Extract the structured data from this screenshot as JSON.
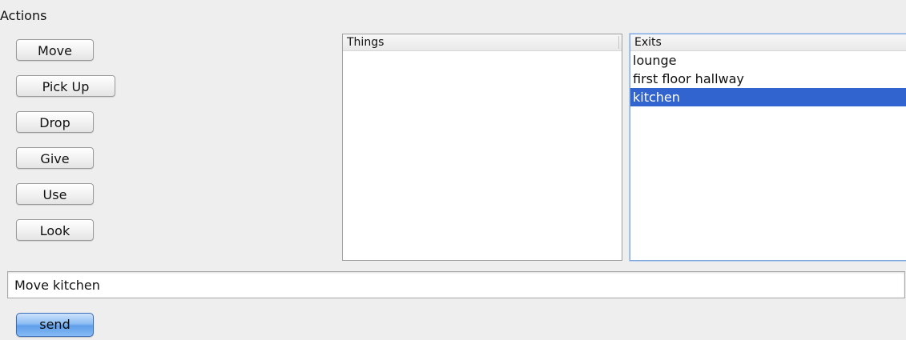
{
  "actions": {
    "title": "Actions",
    "buttons": {
      "move": "Move",
      "pick_up": "Pick Up",
      "drop": "Drop",
      "give": "Give",
      "use": "Use",
      "look": "Look"
    }
  },
  "things_list": {
    "header": "Things",
    "items": []
  },
  "exits_list": {
    "header": "Exits",
    "items": [
      "lounge",
      "first floor hallway",
      "kitchen"
    ],
    "selected": "kitchen"
  },
  "command": {
    "value": "Move kitchen"
  },
  "send": {
    "label": "send"
  },
  "colors": {
    "selection": "#3264d0",
    "send_button": "#5f9ee9",
    "background": "#eeeeee"
  }
}
